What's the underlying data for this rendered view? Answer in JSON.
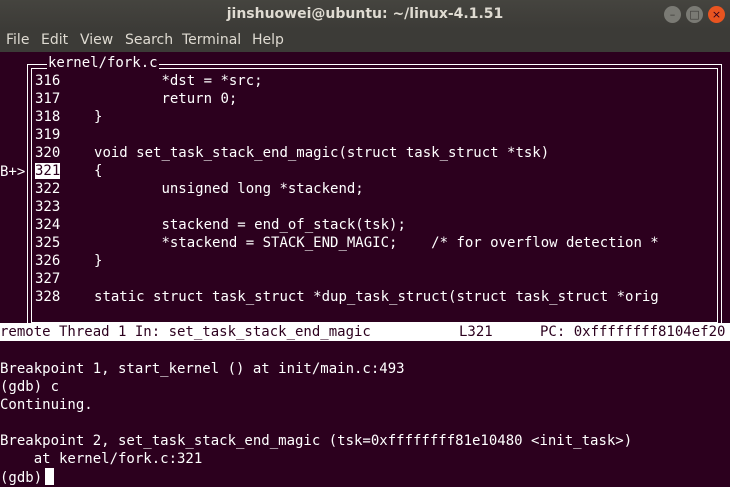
{
  "window": {
    "title": "jinshuowei@ubuntu: ~/linux-4.1.51",
    "minimize": "–",
    "maximize": "□",
    "close": "×"
  },
  "menubar": [
    "File",
    "Edit",
    "View",
    "Search",
    "Terminal",
    "Help"
  ],
  "source": {
    "file": "kernel/fork.c",
    "breakpoint_marker": "B+>",
    "current_line": "321",
    "lines": [
      {
        "num": "316",
        "text": "            *dst = *src;"
      },
      {
        "num": "317",
        "text": "            return 0;"
      },
      {
        "num": "318",
        "text": "    }"
      },
      {
        "num": "319",
        "text": ""
      },
      {
        "num": "320",
        "text": "    void set_task_stack_end_magic(struct task_struct *tsk)"
      },
      {
        "num": "321",
        "text": "    {"
      },
      {
        "num": "322",
        "text": "            unsigned long *stackend;"
      },
      {
        "num": "323",
        "text": ""
      },
      {
        "num": "324",
        "text": "            stackend = end_of_stack(tsk);"
      },
      {
        "num": "325",
        "text": "            *stackend = STACK_END_MAGIC;    /* for overflow detection *"
      },
      {
        "num": "326",
        "text": "    }"
      },
      {
        "num": "327",
        "text": ""
      },
      {
        "num": "328",
        "text": "    static struct task_struct *dup_task_struct(struct task_struct *orig"
      }
    ]
  },
  "status": {
    "thread": "remote Thread 1 In: set_task_stack_end_magic",
    "line": "L321",
    "pc": "PC: 0xffffffff8104ef20"
  },
  "console": {
    "lines": [
      "Breakpoint 1, start_kernel () at init/main.c:493",
      "(gdb) c",
      "Continuing.",
      "",
      "Breakpoint 2, set_task_stack_end_magic (tsk=0xffffffff81e10480 <init_task>)",
      "    at kernel/fork.c:321"
    ],
    "prompt": "(gdb)"
  }
}
